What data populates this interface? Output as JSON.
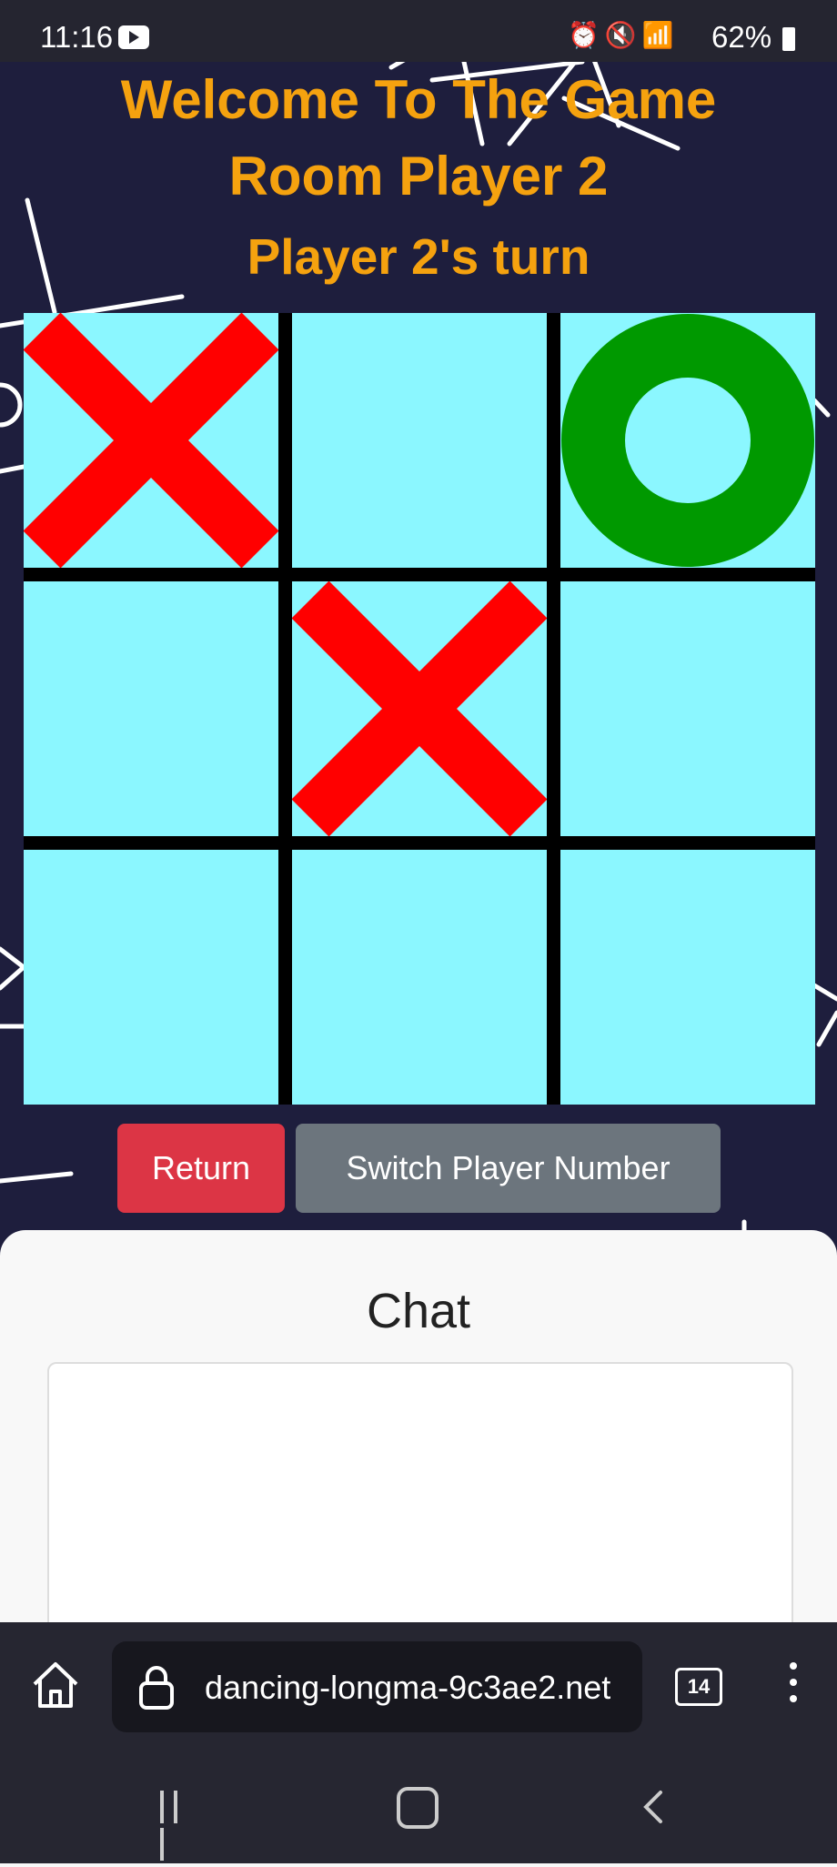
{
  "status_bar": {
    "time": "11:16",
    "battery": "62%",
    "icons": [
      "youtube-icon",
      "alarm-icon",
      "mute-icon",
      "wifi-icon",
      "signal-icon",
      "battery-icon"
    ]
  },
  "game": {
    "welcome_line1": "Welcome To The Game",
    "welcome_line2": "Room Player 2",
    "turn_text": "Player 2's turn",
    "board": [
      "X",
      "",
      "O",
      "",
      "X",
      "",
      "",
      "",
      ""
    ],
    "colors": {
      "cell": "#8bf7ff",
      "x": "#ff0000",
      "o": "#009900",
      "title": "#f5a20f"
    }
  },
  "buttons": {
    "return_label": "Return",
    "switch_label": "Switch Player Number"
  },
  "chat": {
    "title": "Chat"
  },
  "browser": {
    "url": "dancing-longma-9c3ae2.net",
    "tab_count": "14"
  }
}
